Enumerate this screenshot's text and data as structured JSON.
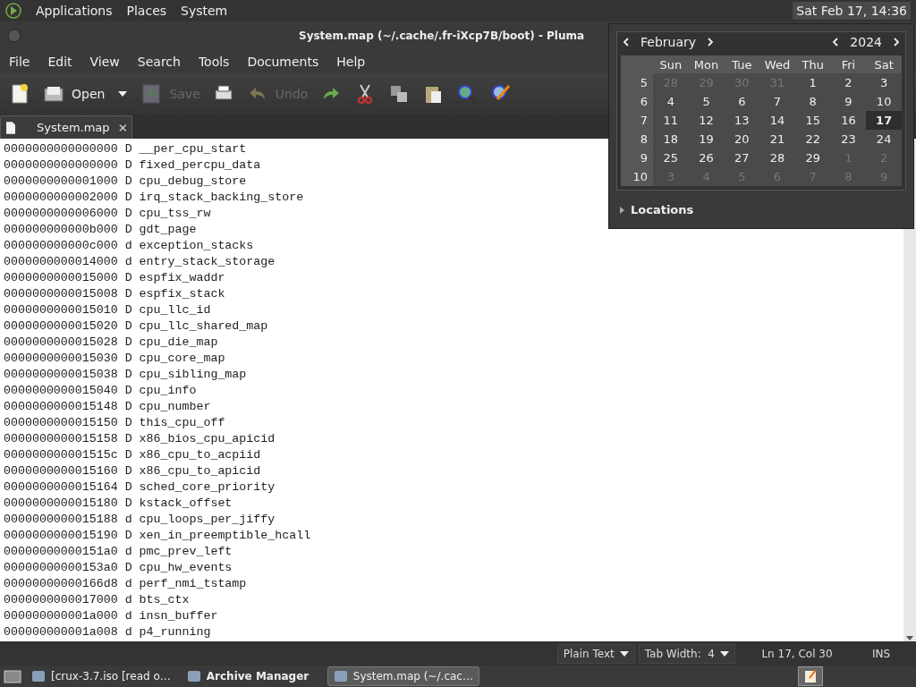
{
  "top_panel": {
    "menus": [
      "Applications",
      "Places",
      "System"
    ],
    "clock": "Sat Feb 17, 14:36"
  },
  "window": {
    "title": "System.map (~/.cache/.fr-iXcp7B/boot) - Pluma"
  },
  "menubar": [
    "File",
    "Edit",
    "View",
    "Search",
    "Tools",
    "Documents",
    "Help"
  ],
  "toolbar": [
    {
      "kind": "new",
      "disabled": false
    },
    {
      "kind": "open",
      "label": "Open",
      "disabled": false
    },
    {
      "kind": "dropdown",
      "disabled": false
    },
    {
      "kind": "save",
      "label": "Save",
      "disabled": true
    },
    {
      "kind": "print",
      "disabled": false
    },
    {
      "kind": "undo",
      "label": "Undo",
      "disabled": true
    },
    {
      "kind": "redo",
      "disabled": false
    },
    {
      "kind": "cut",
      "disabled": false
    },
    {
      "kind": "copy",
      "disabled": false
    },
    {
      "kind": "paste",
      "disabled": false
    },
    {
      "kind": "find",
      "disabled": false
    },
    {
      "kind": "replace",
      "disabled": false
    }
  ],
  "tabs": [
    {
      "label": "System.map",
      "selected": true
    }
  ],
  "editor_lines": [
    "0000000000000000 D __per_cpu_start",
    "0000000000000000 D fixed_percpu_data",
    "0000000000001000 D cpu_debug_store",
    "0000000000002000 D irq_stack_backing_store",
    "0000000000006000 D cpu_tss_rw",
    "000000000000b000 D gdt_page",
    "000000000000c000 d exception_stacks",
    "0000000000014000 d entry_stack_storage",
    "0000000000015000 D espfix_waddr",
    "0000000000015008 D espfix_stack",
    "0000000000015010 D cpu_llc_id",
    "0000000000015020 D cpu_llc_shared_map",
    "0000000000015028 D cpu_die_map",
    "0000000000015030 D cpu_core_map",
    "0000000000015038 D cpu_sibling_map",
    "0000000000015040 D cpu_info",
    "0000000000015148 D cpu_number",
    "0000000000015150 D this_cpu_off",
    "0000000000015158 D x86_bios_cpu_apicid",
    "000000000001515c D x86_cpu_to_acpiid",
    "0000000000015160 D x86_cpu_to_apicid",
    "0000000000015164 D sched_core_priority",
    "0000000000015180 D kstack_offset",
    "0000000000015188 d cpu_loops_per_jiffy",
    "0000000000015190 D xen_in_preemptible_hcall",
    "00000000000151a0 d pmc_prev_left",
    "00000000000153a0 D cpu_hw_events",
    "00000000000166d8 d perf_nmi_tstamp",
    "0000000000017000 d bts_ctx",
    "000000000001a000 d insn_buffer",
    "000000000001a008 d p4_running"
  ],
  "status_bar": {
    "language": "Plain Text",
    "tab_width": "Tab Width:  4",
    "position": "Ln 17, Col 30",
    "mode": "INS"
  },
  "taskbar": {
    "windows": [
      {
        "label": "[crux-3.7.iso [read o…",
        "selected": false,
        "bold": false
      },
      {
        "label": "Archive Manager",
        "selected": false,
        "bold": true
      },
      {
        "label": "System.map (~/.cac…",
        "selected": true,
        "bold": false
      }
    ]
  },
  "calendar": {
    "month": "February",
    "year": "2024",
    "weekdays": [
      "Sun",
      "Mon",
      "Tue",
      "Wed",
      "Thu",
      "Fri",
      "Sat"
    ],
    "weeks": [
      {
        "number": "5",
        "days": [
          {
            "label": "28",
            "other_month": true,
            "selected": false
          },
          {
            "label": "29",
            "other_month": true,
            "selected": false
          },
          {
            "label": "30",
            "other_month": true,
            "selected": false
          },
          {
            "label": "31",
            "other_month": true,
            "selected": false
          },
          {
            "label": "1",
            "other_month": false,
            "selected": false
          },
          {
            "label": "2",
            "other_month": false,
            "selected": false
          },
          {
            "label": "3",
            "other_month": false,
            "selected": false
          }
        ]
      },
      {
        "number": "6",
        "days": [
          {
            "label": "4",
            "other_month": false,
            "selected": false
          },
          {
            "label": "5",
            "other_month": false,
            "selected": false
          },
          {
            "label": "6",
            "other_month": false,
            "selected": false
          },
          {
            "label": "7",
            "other_month": false,
            "selected": false
          },
          {
            "label": "8",
            "other_month": false,
            "selected": false
          },
          {
            "label": "9",
            "other_month": false,
            "selected": false
          },
          {
            "label": "10",
            "other_month": false,
            "selected": false
          }
        ]
      },
      {
        "number": "7",
        "days": [
          {
            "label": "11",
            "other_month": false,
            "selected": false
          },
          {
            "label": "12",
            "other_month": false,
            "selected": false
          },
          {
            "label": "13",
            "other_month": false,
            "selected": false
          },
          {
            "label": "14",
            "other_month": false,
            "selected": false
          },
          {
            "label": "15",
            "other_month": false,
            "selected": false
          },
          {
            "label": "16",
            "other_month": false,
            "selected": false
          },
          {
            "label": "17",
            "other_month": false,
            "selected": true
          }
        ]
      },
      {
        "number": "8",
        "days": [
          {
            "label": "18",
            "other_month": false,
            "selected": false
          },
          {
            "label": "19",
            "other_month": false,
            "selected": false
          },
          {
            "label": "20",
            "other_month": false,
            "selected": false
          },
          {
            "label": "21",
            "other_month": false,
            "selected": false
          },
          {
            "label": "22",
            "other_month": false,
            "selected": false
          },
          {
            "label": "23",
            "other_month": false,
            "selected": false
          },
          {
            "label": "24",
            "other_month": false,
            "selected": false
          }
        ]
      },
      {
        "number": "9",
        "days": [
          {
            "label": "25",
            "other_month": false,
            "selected": false
          },
          {
            "label": "26",
            "other_month": false,
            "selected": false
          },
          {
            "label": "27",
            "other_month": false,
            "selected": false
          },
          {
            "label": "28",
            "other_month": false,
            "selected": false
          },
          {
            "label": "29",
            "other_month": false,
            "selected": false
          },
          {
            "label": "1",
            "other_month": true,
            "selected": false
          },
          {
            "label": "2",
            "other_month": true,
            "selected": false
          }
        ]
      },
      {
        "number": "10",
        "days": [
          {
            "label": "3",
            "other_month": true,
            "selected": false
          },
          {
            "label": "4",
            "other_month": true,
            "selected": false
          },
          {
            "label": "5",
            "other_month": true,
            "selected": false
          },
          {
            "label": "6",
            "other_month": true,
            "selected": false
          },
          {
            "label": "7",
            "other_month": true,
            "selected": false
          },
          {
            "label": "8",
            "other_month": true,
            "selected": false
          },
          {
            "label": "9",
            "other_month": true,
            "selected": false
          }
        ]
      }
    ],
    "locations": {
      "label": "Locations",
      "expanded": false
    }
  }
}
